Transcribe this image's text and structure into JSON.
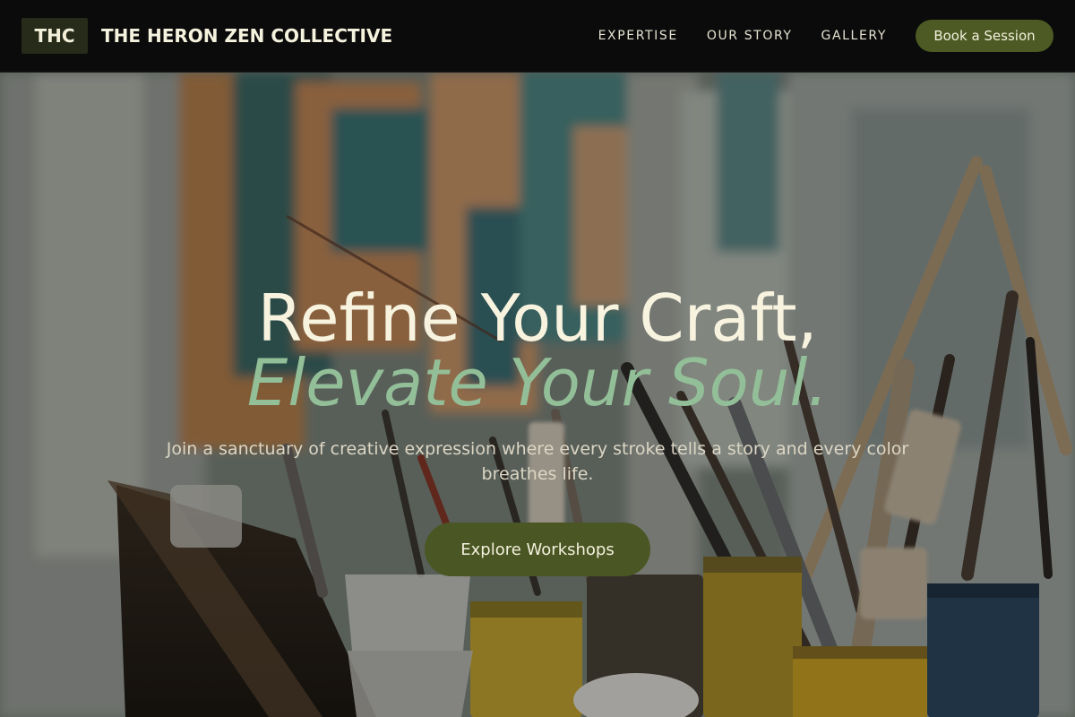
{
  "header": {
    "logo_text": "THC",
    "brand_name": "THE HERON ZEN COLLECTIVE",
    "nav": [
      {
        "label": "EXPERTISE"
      },
      {
        "label": "OUR STORY"
      },
      {
        "label": "GALLERY"
      }
    ],
    "cta_label": "Book a Session"
  },
  "hero": {
    "headline_line1": "Refine Your Craft,",
    "headline_line2": "Elevate Your Soul.",
    "subtitle": "Join a sanctuary of creative expression where every stroke tells a story and every color breathes life.",
    "button_label": "Explore Workshops"
  },
  "colors": {
    "header_bg": "#0b0b0b",
    "accent_olive": "#4d5a23",
    "headline_cream": "#f7f3df",
    "headline_green": "#93bf98"
  }
}
